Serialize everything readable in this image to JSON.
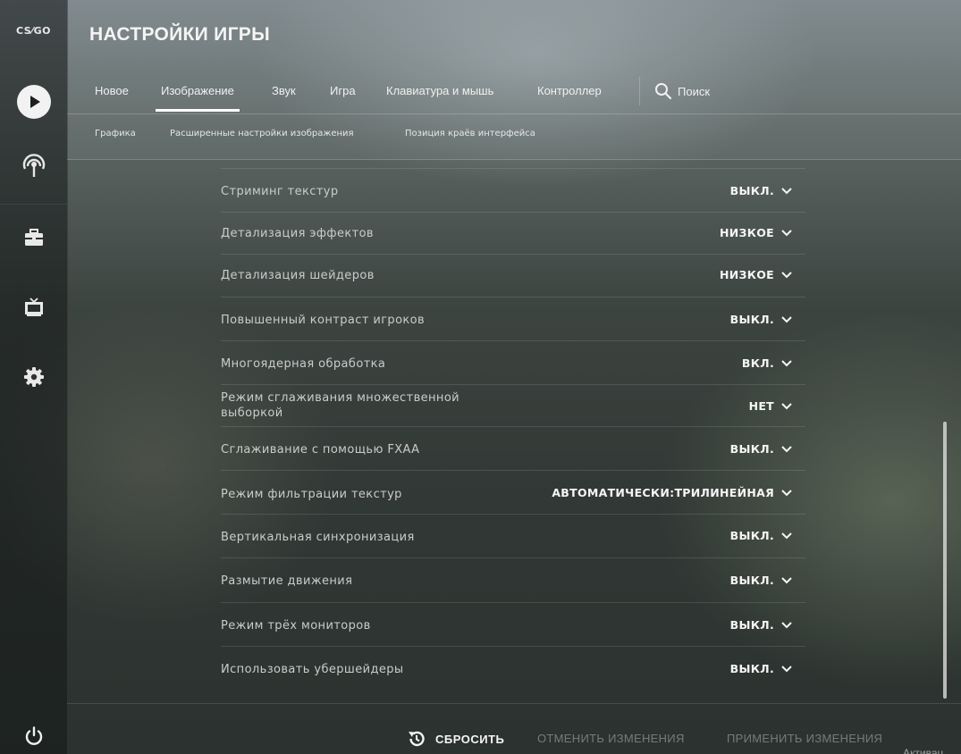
{
  "sidebar": {
    "logo_text": "CS⁄GO",
    "items": [
      {
        "icon": "play-icon"
      },
      {
        "icon": "broadcast-icon"
      },
      {
        "icon": "briefcase-icon"
      },
      {
        "icon": "tv-icon"
      },
      {
        "icon": "gear-icon"
      },
      {
        "icon": "power-icon"
      }
    ]
  },
  "header": {
    "title": "НАСТРОЙКИ ИГРЫ",
    "tabs": [
      {
        "label": "Новое"
      },
      {
        "label": "Изображение",
        "active": true
      },
      {
        "label": "Звук"
      },
      {
        "label": "Игра"
      },
      {
        "label": "Клавиатура и мышь"
      },
      {
        "label": "Контроллер"
      }
    ],
    "search_label": "Поиск",
    "subtabs": [
      {
        "label": "Графика"
      },
      {
        "label": "Расширенные настройки изображения"
      },
      {
        "label": "Позиция краёв интерфейса"
      }
    ]
  },
  "settings": [
    {
      "label": "Стриминг текстур",
      "value": "ВЫКЛ."
    },
    {
      "label": "Детализация эффектов",
      "value": "НИЗКОЕ"
    },
    {
      "label": "Детализация шейдеров",
      "value": "НИЗКОЕ"
    },
    {
      "label": "Повышенный контраст игроков",
      "value": "ВЫКЛ."
    },
    {
      "label": "Многоядерная обработка",
      "value": "ВКЛ."
    },
    {
      "label": "Режим сглаживания множественной выборкой",
      "value": "НЕТ"
    },
    {
      "label": "Сглаживание с помощью FXAA",
      "value": "ВЫКЛ."
    },
    {
      "label": "Режим фильтрации текстур",
      "value": "АВТОМАТИЧЕСКИ:ТРИЛИНЕЙНАЯ"
    },
    {
      "label": "Вертикальная синхронизация",
      "value": "ВЫКЛ."
    },
    {
      "label": "Размытие движения",
      "value": "ВЫКЛ."
    },
    {
      "label": "Режим трёх мониторов",
      "value": "ВЫКЛ."
    },
    {
      "label": "Использовать убершейдеры",
      "value": "ВЫКЛ."
    }
  ],
  "footer": {
    "reset_label": "СБРОСИТЬ",
    "cancel_label": "ОТМЕНИТЬ ИЗМЕНЕНИЯ",
    "apply_label": "ПРИМЕНИТЬ ИЗМЕНЕНИЯ",
    "corner_text": "Активац"
  }
}
